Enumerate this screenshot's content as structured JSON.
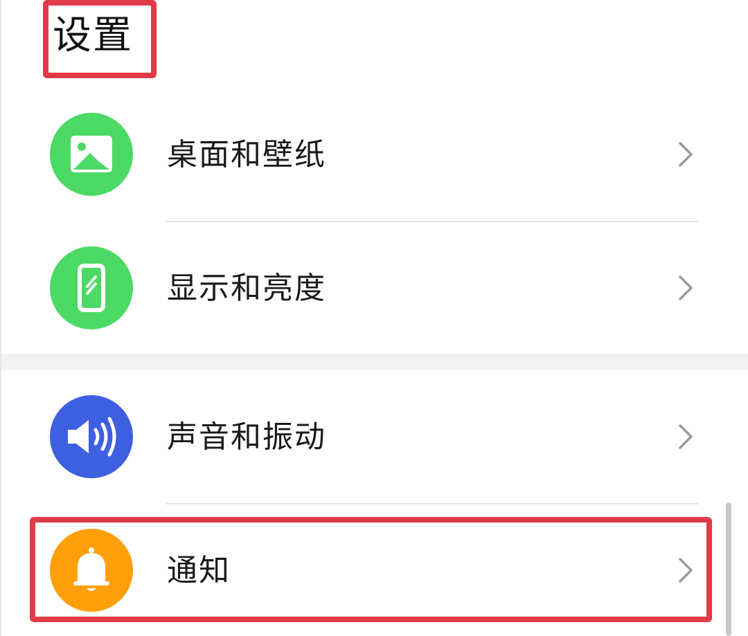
{
  "page": {
    "title": "设置"
  },
  "settings_items": [
    {
      "label": "桌面和壁纸",
      "icon": "wallpaper-icon",
      "icon_color": "#4cd964"
    },
    {
      "label": "显示和亮度",
      "icon": "phone-display-icon",
      "icon_color": "#4cd964"
    },
    {
      "label": "声音和振动",
      "icon": "speaker-icon",
      "icon_color": "#3e5fe0"
    },
    {
      "label": "通知",
      "icon": "bell-icon",
      "icon_color": "#ff9f0a"
    }
  ],
  "colors": {
    "highlight": "#e13a48",
    "chevron": "#9a9a9a"
  }
}
